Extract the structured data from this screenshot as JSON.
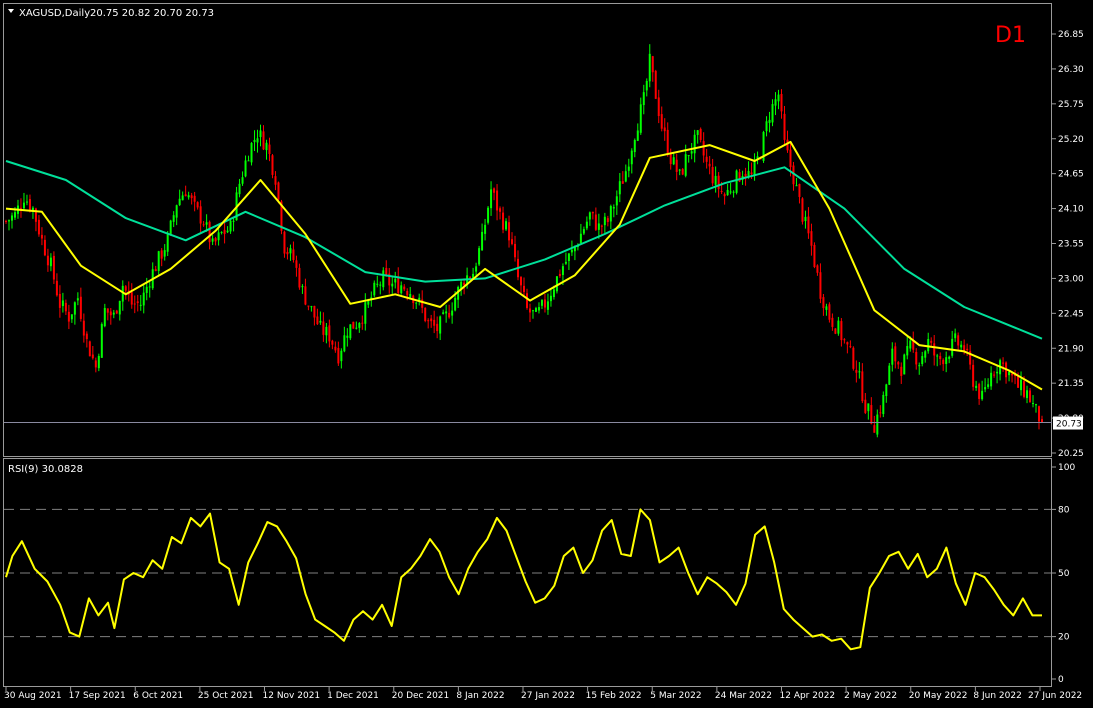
{
  "symbol_label": "XAGUSD,Daily",
  "ohlc_label": "20.75 20.82 20.70 20.73",
  "timeframe_label": "D1",
  "rsi_label": "RSI(9) 30.0828",
  "current_price_label": "20.73",
  "colors": {
    "background": "#000000",
    "bull_candle": "#00ff00",
    "bear_candle": "#ff0000",
    "ma_fast": "#ffff00",
    "ma_slow": "#00e09a",
    "rsi_line": "#ffff00",
    "timeframe_label": "#ff0000",
    "axis_text": "#ffffff",
    "grid_level": "#808080"
  },
  "chart_data": [
    {
      "type": "candlestick",
      "title": "XAGUSD,Daily",
      "price_axis_ticks": [
        "26.85",
        "26.30",
        "25.75",
        "25.20",
        "24.65",
        "24.10",
        "23.55",
        "23.00",
        "22.45",
        "21.90",
        "21.35",
        "20.80",
        "20.25"
      ],
      "ylim": [
        20.25,
        26.85
      ],
      "x_tick_labels": [
        "30 Aug 2021",
        "17 Sep 2021",
        "6 Oct 2021",
        "25 Oct 2021",
        "12 Nov 2021",
        "1 Dec 2021",
        "20 Dec 2021",
        "8 Jan 2022",
        "27 Jan 2022",
        "15 Feb 2022",
        "5 Mar 2022",
        "24 Mar 2022",
        "12 Apr 2022",
        "2 May 2022",
        "20 May 2022",
        "8 Jun 2022",
        "27 Jun 2022"
      ],
      "last_price": 20.73,
      "price_path": [
        [
          0,
          23.9
        ],
        [
          3,
          24.0
        ],
        [
          6,
          24.3
        ],
        [
          9,
          24.1
        ],
        [
          12,
          23.6
        ],
        [
          15,
          23.2
        ],
        [
          18,
          22.6
        ],
        [
          21,
          22.4
        ],
        [
          24,
          22.7
        ],
        [
          27,
          22.0
        ],
        [
          30,
          21.6
        ],
        [
          33,
          22.5
        ],
        [
          36,
          22.4
        ],
        [
          39,
          22.9
        ],
        [
          42,
          22.6
        ],
        [
          45,
          22.6
        ],
        [
          48,
          23.0
        ],
        [
          51,
          23.3
        ],
        [
          54,
          23.6
        ],
        [
          57,
          24.2
        ],
        [
          60,
          24.4
        ],
        [
          63,
          24.1
        ],
        [
          66,
          23.9
        ],
        [
          69,
          23.5
        ],
        [
          72,
          23.7
        ],
        [
          75,
          23.8
        ],
        [
          78,
          24.5
        ],
        [
          81,
          25.0
        ],
        [
          84,
          25.3
        ],
        [
          87,
          25.1
        ],
        [
          90,
          24.6
        ],
        [
          93,
          23.5
        ],
        [
          96,
          23.3
        ],
        [
          99,
          22.8
        ],
        [
          102,
          22.5
        ],
        [
          105,
          22.2
        ],
        [
          108,
          22.1
        ],
        [
          111,
          21.8
        ],
        [
          114,
          22.2
        ],
        [
          117,
          22.3
        ],
        [
          120,
          22.5
        ],
        [
          123,
          22.8
        ],
        [
          126,
          23.0
        ],
        [
          129,
          22.9
        ],
        [
          132,
          22.9
        ],
        [
          135,
          22.8
        ],
        [
          138,
          22.6
        ],
        [
          141,
          22.3
        ],
        [
          144,
          22.2
        ],
        [
          147,
          22.4
        ],
        [
          150,
          22.7
        ],
        [
          153,
          23.0
        ],
        [
          156,
          23.1
        ],
        [
          159,
          23.6
        ],
        [
          162,
          24.4
        ],
        [
          165,
          24.0
        ],
        [
          168,
          23.7
        ],
        [
          171,
          23.0
        ],
        [
          174,
          22.5
        ],
        [
          177,
          22.4
        ],
        [
          180,
          22.6
        ],
        [
          183,
          22.9
        ],
        [
          186,
          23.2
        ],
        [
          189,
          23.4
        ],
        [
          192,
          23.7
        ],
        [
          195,
          24.0
        ],
        [
          198,
          23.8
        ],
        [
          201,
          23.9
        ],
        [
          204,
          24.3
        ],
        [
          207,
          24.7
        ],
        [
          210,
          25.3
        ],
        [
          213,
          25.8
        ],
        [
          215,
          26.4
        ],
        [
          217,
          25.9
        ],
        [
          219,
          25.4
        ],
        [
          222,
          24.9
        ],
        [
          225,
          24.6
        ],
        [
          228,
          25.0
        ],
        [
          231,
          25.2
        ],
        [
          234,
          24.8
        ],
        [
          237,
          24.5
        ],
        [
          240,
          24.3
        ],
        [
          243,
          24.5
        ],
        [
          246,
          24.7
        ],
        [
          249,
          24.6
        ],
        [
          252,
          25.0
        ],
        [
          255,
          25.6
        ],
        [
          258,
          25.9
        ],
        [
          260,
          25.1
        ],
        [
          263,
          24.6
        ],
        [
          266,
          24.0
        ],
        [
          269,
          23.5
        ],
        [
          272,
          22.8
        ],
        [
          275,
          22.4
        ],
        [
          278,
          22.2
        ],
        [
          281,
          21.9
        ],
        [
          284,
          21.6
        ],
        [
          287,
          21.0
        ],
        [
          290,
          20.7
        ],
        [
          293,
          21.1
        ],
        [
          296,
          21.8
        ],
        [
          299,
          21.6
        ],
        [
          302,
          21.9
        ],
        [
          305,
          21.7
        ],
        [
          308,
          22.0
        ],
        [
          311,
          21.7
        ],
        [
          314,
          21.8
        ],
        [
          317,
          22.0
        ],
        [
          320,
          21.9
        ],
        [
          323,
          21.4
        ],
        [
          326,
          21.1
        ],
        [
          329,
          21.5
        ],
        [
          332,
          21.7
        ],
        [
          335,
          21.5
        ],
        [
          338,
          21.3
        ],
        [
          341,
          21.2
        ],
        [
          344,
          20.9
        ],
        [
          346,
          20.73
        ]
      ],
      "series": [
        {
          "name": "",
          "values": [
            [
              0,
              24.85
            ],
            [
              20,
              24.55
            ],
            [
              40,
              23.95
            ],
            [
              60,
              23.6
            ],
            [
              80,
              24.05
            ],
            [
              100,
              23.65
            ],
            [
              120,
              23.1
            ],
            [
              140,
              22.95
            ],
            [
              160,
              23.0
            ],
            [
              180,
              23.3
            ],
            [
              200,
              23.7
            ],
            [
              220,
              24.15
            ],
            [
              240,
              24.5
            ],
            [
              260,
              24.75
            ],
            [
              280,
              24.1
            ],
            [
              300,
              23.15
            ],
            [
              320,
              22.55
            ],
            [
              346,
              22.05
            ]
          ]
        },
        {
          "name": "",
          "values": [
            [
              0,
              24.1
            ],
            [
              12,
              24.05
            ],
            [
              25,
              23.2
            ],
            [
              40,
              22.75
            ],
            [
              55,
              23.15
            ],
            [
              70,
              23.75
            ],
            [
              85,
              24.55
            ],
            [
              100,
              23.7
            ],
            [
              115,
              22.6
            ],
            [
              130,
              22.75
            ],
            [
              145,
              22.55
            ],
            [
              160,
              23.15
            ],
            [
              175,
              22.65
            ],
            [
              190,
              23.05
            ],
            [
              205,
              23.85
            ],
            [
              215,
              24.9
            ],
            [
              235,
              25.1
            ],
            [
              250,
              24.85
            ],
            [
              262,
              25.15
            ],
            [
              275,
              24.1
            ],
            [
              290,
              22.5
            ],
            [
              305,
              21.95
            ],
            [
              320,
              21.85
            ],
            [
              335,
              21.55
            ],
            [
              346,
              21.25
            ]
          ]
        }
      ]
    },
    {
      "type": "line",
      "title": "RSI(9) 30.0828",
      "y_tick_labels": [
        "100",
        "80",
        "50",
        "20",
        "0"
      ],
      "levels": [
        80,
        50,
        20
      ],
      "ylim": [
        0,
        100
      ],
      "series": [
        {
          "name": "",
          "values": [
            [
              0,
              48
            ],
            [
              2,
              58
            ],
            [
              5,
              65
            ],
            [
              9,
              52
            ],
            [
              13,
              46
            ],
            [
              17,
              35
            ],
            [
              20,
              22
            ],
            [
              23,
              20
            ],
            [
              26,
              38
            ],
            [
              29,
              30
            ],
            [
              32,
              36
            ],
            [
              34,
              24
            ],
            [
              37,
              47
            ],
            [
              40,
              50
            ],
            [
              43,
              48
            ],
            [
              46,
              56
            ],
            [
              49,
              52
            ],
            [
              52,
              67
            ],
            [
              55,
              64
            ],
            [
              58,
              76
            ],
            [
              61,
              72
            ],
            [
              64,
              78
            ],
            [
              67,
              55
            ],
            [
              70,
              52
            ],
            [
              73,
              35
            ],
            [
              76,
              55
            ],
            [
              79,
              64
            ],
            [
              82,
              74
            ],
            [
              85,
              72
            ],
            [
              88,
              65
            ],
            [
              91,
              57
            ],
            [
              94,
              40
            ],
            [
              97,
              28
            ],
            [
              100,
              25
            ],
            [
              103,
              22
            ],
            [
              106,
              18
            ],
            [
              109,
              28
            ],
            [
              112,
              32
            ],
            [
              115,
              28
            ],
            [
              118,
              35
            ],
            [
              121,
              25
            ],
            [
              124,
              48
            ],
            [
              127,
              52
            ],
            [
              130,
              58
            ],
            [
              133,
              66
            ],
            [
              136,
              60
            ],
            [
              139,
              48
            ],
            [
              142,
              40
            ],
            [
              145,
              52
            ],
            [
              148,
              60
            ],
            [
              151,
              66
            ],
            [
              154,
              76
            ],
            [
              157,
              70
            ],
            [
              160,
              58
            ],
            [
              163,
              46
            ],
            [
              166,
              36
            ],
            [
              169,
              38
            ],
            [
              172,
              44
            ],
            [
              175,
              58
            ],
            [
              178,
              62
            ],
            [
              181,
              50
            ],
            [
              184,
              56
            ],
            [
              187,
              70
            ],
            [
              190,
              75
            ],
            [
              193,
              59
            ],
            [
              196,
              58
            ],
            [
              199,
              80
            ],
            [
              202,
              75
            ],
            [
              205,
              55
            ],
            [
              208,
              58
            ],
            [
              211,
              62
            ],
            [
              214,
              50
            ],
            [
              217,
              40
            ],
            [
              220,
              48
            ],
            [
              223,
              45
            ],
            [
              226,
              41
            ],
            [
              229,
              35
            ],
            [
              232,
              45
            ],
            [
              235,
              68
            ],
            [
              238,
              72
            ],
            [
              241,
              55
            ],
            [
              244,
              33
            ],
            [
              247,
              28
            ],
            [
              250,
              24
            ],
            [
              253,
              20
            ],
            [
              256,
              21
            ],
            [
              259,
              18
            ],
            [
              262,
              19
            ],
            [
              265,
              14
            ],
            [
              268,
              15
            ],
            [
              271,
              43
            ],
            [
              274,
              50
            ],
            [
              277,
              58
            ],
            [
              280,
              60
            ],
            [
              283,
              52
            ],
            [
              286,
              59
            ],
            [
              289,
              48
            ],
            [
              292,
              52
            ],
            [
              295,
              62
            ],
            [
              298,
              45
            ],
            [
              301,
              35
            ],
            [
              304,
              50
            ],
            [
              307,
              48
            ],
            [
              310,
              42
            ],
            [
              313,
              35
            ],
            [
              316,
              30
            ],
            [
              319,
              38
            ],
            [
              322,
              30
            ],
            [
              325,
              30
            ]
          ]
        }
      ]
    }
  ]
}
